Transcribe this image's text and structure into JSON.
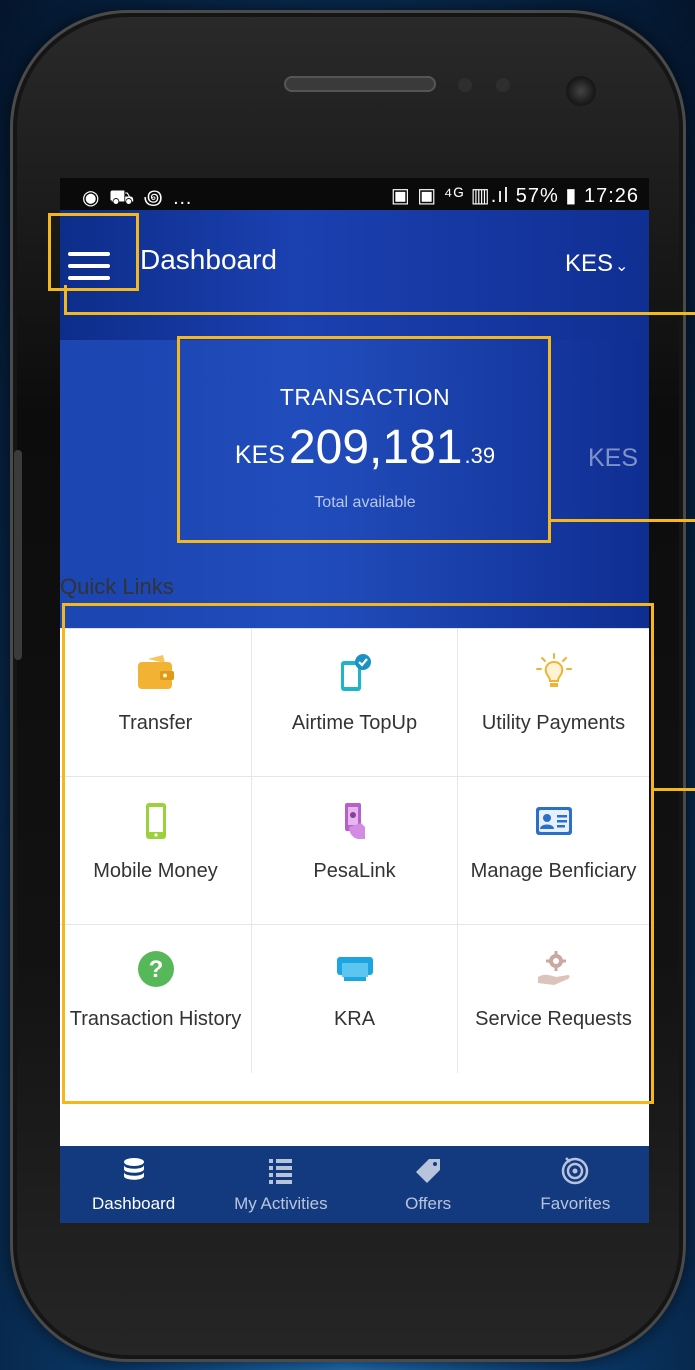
{
  "status_bar": {
    "left_icons": "◉ ⛟ ꩜ …",
    "right_text": "▣ ▣ ⁴ᴳ ▥.ıl 57% ▮ 17:26"
  },
  "app_bar": {
    "title": "Dashboard",
    "currency": "KES",
    "currency_chevron": "⌄"
  },
  "balance_card": {
    "label": "TRANSACTION",
    "currency": "KES",
    "amount_whole": "209,181",
    "amount_decimal": ".39",
    "sub_label": "Total available"
  },
  "next_card_peek": {
    "currency": "KES"
  },
  "quick_links": {
    "title": "Quick Links",
    "items": [
      {
        "label": "Transfer",
        "icon": "wallet-icon",
        "color": "#f2b233"
      },
      {
        "label": "Airtime TopUp",
        "icon": "phone-topup-icon",
        "color": "#1cb5c9"
      },
      {
        "label": "Utility Payments",
        "icon": "lightbulb-icon",
        "color": "#f2b233"
      },
      {
        "label": "Mobile Money",
        "icon": "mobile-phone-icon",
        "color": "#9bd13a"
      },
      {
        "label": "PesaLink",
        "icon": "hand-phone-icon",
        "color": "#b760c9"
      },
      {
        "label": "Manage Benficiary",
        "icon": "id-card-icon",
        "color": "#2a6fc9"
      },
      {
        "label": "Transaction History",
        "icon": "question-icon",
        "color": "#57b85a"
      },
      {
        "label": "KRA",
        "icon": "card-terminal-icon",
        "color": "#1ca5e0"
      },
      {
        "label": "Service Requests",
        "icon": "gear-hand-icon",
        "color": "#c9a9a0"
      }
    ]
  },
  "bottom_nav": {
    "items": [
      {
        "label": "Dashboard",
        "icon": "database-icon",
        "active": true
      },
      {
        "label": "My Activities",
        "icon": "list-icon",
        "active": false
      },
      {
        "label": "Offers",
        "icon": "tag-icon",
        "active": false
      },
      {
        "label": "Favorites",
        "icon": "target-icon",
        "active": false
      }
    ]
  },
  "colors": {
    "app_bar": "#13348f",
    "nav_bar": "#133a7e",
    "highlight": "#f5b81c"
  }
}
